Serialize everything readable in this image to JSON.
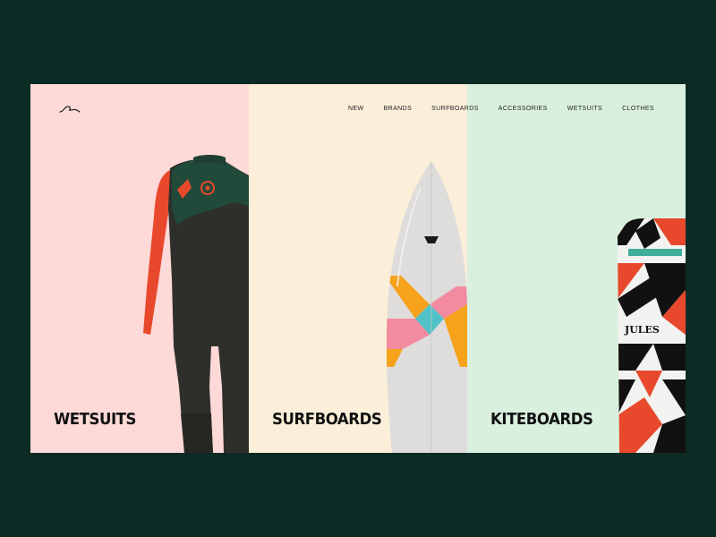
{
  "colors": {
    "background": "#0d2b25",
    "panel_wetsuits": "#fdd9d7",
    "panel_surfboards": "#fbefd9",
    "panel_kiteboards": "#d9f0df"
  },
  "header": {
    "logo_icon": "wave-icon",
    "nav": [
      "NEW",
      "BRANDS",
      "SURFBOARDS",
      "ACCESSORIES",
      "WETSUITS",
      "CLOTHES"
    ]
  },
  "panels": [
    {
      "label": "WETSUITS",
      "image": "wetsuit"
    },
    {
      "label": "SURFBOARDS",
      "image": "surfboard"
    },
    {
      "label": "KITEBOARDS",
      "image": "kiteboard",
      "board_text": "JULES"
    }
  ]
}
